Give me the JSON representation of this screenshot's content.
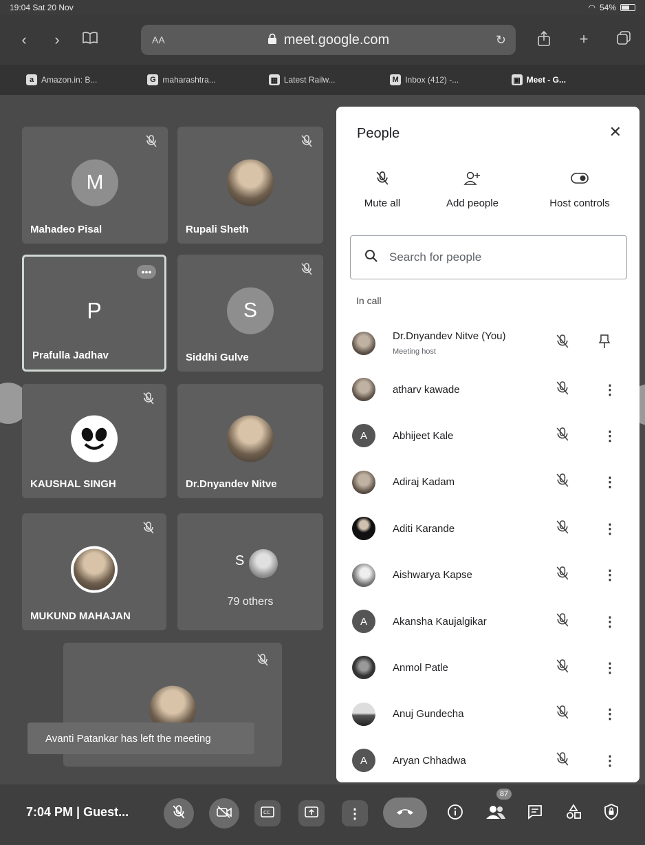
{
  "status_bar": {
    "time_date": "19:04 Sat 20 Nov",
    "battery": "54%"
  },
  "browser": {
    "aa_label": "AA",
    "url": "meet.google.com",
    "tabs": [
      {
        "favicon": "a",
        "label": "Amazon.in: B..."
      },
      {
        "favicon": "G",
        "label": "maharashtra..."
      },
      {
        "favicon": "▦",
        "label": "Latest Railw..."
      },
      {
        "favicon": "M",
        "label": "Inbox (412) -..."
      },
      {
        "favicon": "▣",
        "label": "Meet - G..."
      }
    ]
  },
  "tiles": [
    {
      "name": "Mahadeo Pisal",
      "initial": "M"
    },
    {
      "name": "Rupali Sheth",
      "initial": ""
    },
    {
      "name": "Prafulla Jadhav",
      "initial": "P",
      "more": "•••"
    },
    {
      "name": "Siddhi Gulve",
      "initial": "S"
    },
    {
      "name": "KAUSHAL SINGH",
      "initial": ""
    },
    {
      "name": "Dr.Dnyandev Nitve",
      "initial": ""
    },
    {
      "name": "MUKUND MAHAJAN",
      "initial": ""
    },
    {
      "name": "",
      "initial": "S",
      "others": "79 others"
    }
  ],
  "toast": "Avanti Patankar has left the meeting",
  "panel": {
    "title": "People",
    "actions": {
      "mute_all": "Mute all",
      "add_people": "Add people",
      "host_controls": "Host controls"
    },
    "search_placeholder": "Search for people",
    "section": "In call",
    "participants": [
      {
        "name": "Dr.Dnyandev Nitve (You)",
        "sub": "Meeting host",
        "initial": ""
      },
      {
        "name": "atharv kawade",
        "initial": ""
      },
      {
        "name": "Abhijeet Kale",
        "initial": "A"
      },
      {
        "name": "Adiraj Kadam",
        "initial": ""
      },
      {
        "name": "Aditi Karande",
        "initial": ""
      },
      {
        "name": "Aishwarya Kapse",
        "initial": ""
      },
      {
        "name": "Akansha Kaujalgikar",
        "initial": "A"
      },
      {
        "name": "Anmol Patle",
        "initial": ""
      },
      {
        "name": "Anuj Gundecha",
        "initial": ""
      },
      {
        "name": "Aryan Chhadwa",
        "initial": "A"
      }
    ]
  },
  "bottom_bar": {
    "time_label": "7:04 PM  |  Guest...",
    "people_count": "87"
  },
  "colors": {
    "panel_bg": "#ffffff",
    "grid_bg": "#4a4a4a",
    "tile_bg": "#5e5e5e"
  }
}
